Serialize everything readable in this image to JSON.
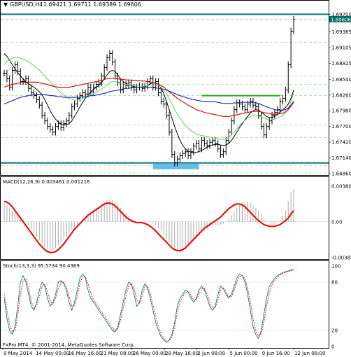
{
  "header": {
    "symbol_text": "GBPUSD,H4",
    "ohlc_text": "1.69421 1.69711 1.69389 1.69606"
  },
  "indicators": {
    "macd_label": "MACD(12,26,9) 0.003461 0.001216",
    "stoch_label": "Stoch(13,3,3) 95.5734 90.4369"
  },
  "copyright": "FxPro MT4, © 2001-2014, MetaQuotes Software Corp.",
  "colors": {
    "price_bars": "#000000",
    "ma_slow": "#2233aa",
    "ma_mid": "#cc1111",
    "ma_fast_green": "#66cc66",
    "ma_dark": "#000000",
    "support_line": "#117777",
    "resistance_mark": "#22aa22",
    "highlight_box": "#66bbee",
    "macd_line": "#ee0000",
    "macd_hist": "#aaaaaa",
    "stoch_main": "#008080",
    "stoch_signal": "#ee0000",
    "price_tag_bg": "#006666"
  },
  "chart_data": [
    {
      "type": "line",
      "name": "price",
      "x_labels": [
        "9 May 2014",
        "14 May 00:00",
        "16 May 16:00",
        "21 May 08:00",
        "26 May 00:00",
        "28 May 16:00",
        "2 Jun 08:00",
        "5 Jun 00:00",
        "9 Jun 16:00",
        "12 Jun 08:00"
      ],
      "y_ticks": [
        "1.69700",
        "1.69385",
        "1.69105",
        "1.68825",
        "1.68540",
        "1.68260",
        "1.67980",
        "1.67700",
        "1.67420",
        "1.67140",
        "1.66860"
      ],
      "price_tags": [
        "1.69700",
        "1.69606",
        "1.69600",
        "1.69200",
        "1.68600",
        "1.68450",
        "1.68250",
        "1.67725",
        "1.67500",
        "1.67000",
        "1.67050",
        "1.66870"
      ],
      "ylim": [
        1.6686,
        1.6978
      ],
      "close": [
        1.6865,
        1.6855,
        1.684,
        1.687,
        1.688,
        1.6868,
        1.685,
        1.685,
        1.6855,
        1.6838,
        1.683,
        1.6825,
        1.6818,
        1.6808,
        1.679,
        1.678,
        1.677,
        1.6765,
        1.676,
        1.677,
        1.6775,
        1.6768,
        1.6775,
        1.678,
        1.679,
        1.6805,
        1.681,
        1.682,
        1.6825,
        1.683,
        1.6828,
        1.684,
        1.6832,
        1.684,
        1.6845,
        1.6848,
        1.686,
        1.6875,
        1.6893,
        1.69,
        1.6885,
        1.686,
        1.6848,
        1.6835,
        1.6845,
        1.6843,
        1.6848,
        1.684,
        1.6835,
        1.684,
        1.6842,
        1.6838,
        1.6842,
        1.685,
        1.6855,
        1.684,
        1.685,
        1.683,
        1.6815,
        1.681,
        1.679,
        1.676,
        1.672,
        1.6705,
        1.6712,
        1.6718,
        1.6722,
        1.6725,
        1.6718,
        1.6725,
        1.6735,
        1.674,
        1.673,
        1.6745,
        1.674,
        1.6736,
        1.6742,
        1.6745,
        1.674,
        1.673,
        1.672,
        1.6725,
        1.6745,
        1.676,
        1.678,
        1.68,
        1.6812,
        1.681,
        1.6805,
        1.68,
        1.681,
        1.6815,
        1.6808,
        1.6805,
        1.679,
        1.677,
        1.6755,
        1.677,
        1.678,
        1.679,
        1.6795,
        1.68,
        1.6815,
        1.682,
        1.6835,
        1.688,
        1.694,
        1.6961
      ],
      "ma_blue": [
        1.681,
        1.6812,
        1.6814,
        1.6816,
        1.6818,
        1.682,
        1.6822,
        1.6823,
        1.6824,
        1.6825,
        1.6826,
        1.6827,
        1.6827,
        1.6827,
        1.6827,
        1.6827,
        1.6826,
        1.6825,
        1.6825,
        1.6824,
        1.6823,
        1.6823,
        1.6822,
        1.6822,
        1.6822,
        1.6822,
        1.6822,
        1.6822,
        1.6822,
        1.6823,
        1.6823,
        1.6824,
        1.6825,
        1.6825,
        1.6826,
        1.6827,
        1.6828,
        1.6829,
        1.683,
        1.6832,
        1.6833,
        1.6834,
        1.6835,
        1.6836,
        1.6837,
        1.6838,
        1.6838,
        1.6839,
        1.6839,
        1.684,
        1.684,
        1.684,
        1.684,
        1.684,
        1.684,
        1.6839,
        1.6839,
        1.6838,
        1.6837,
        1.6836,
        1.6835,
        1.6833,
        1.6831,
        1.6829,
        1.6827,
        1.6825,
        1.6823,
        1.6822,
        1.682,
        1.6819,
        1.6818,
        1.6817,
        1.6816,
        1.6815,
        1.6815,
        1.6814,
        1.6814,
        1.6814,
        1.6814,
        1.6813,
        1.6812,
        1.6811,
        1.6811,
        1.6811,
        1.6811,
        1.6812,
        1.6812,
        1.6813,
        1.6813,
        1.6813,
        1.6813,
        1.6813,
        1.6813,
        1.6812,
        1.6811,
        1.6809,
        1.6807,
        1.6805,
        1.6803,
        1.6802,
        1.68,
        1.6799,
        1.6799,
        1.6799,
        1.68,
        1.6803,
        1.6808,
        1.6815
      ],
      "ma_red": [
        1.684,
        1.6842,
        1.6843,
        1.6845,
        1.6846,
        1.6847,
        1.6848,
        1.6848,
        1.6849,
        1.6849,
        1.6849,
        1.6849,
        1.6849,
        1.6848,
        1.6847,
        1.6846,
        1.6845,
        1.6843,
        1.6842,
        1.6841,
        1.684,
        1.684,
        1.684,
        1.684,
        1.684,
        1.6841,
        1.6842,
        1.6843,
        1.6844,
        1.6845,
        1.6846,
        1.6847,
        1.6848,
        1.6849,
        1.685,
        1.6851,
        1.6852,
        1.6854,
        1.6855,
        1.6856,
        1.6856,
        1.6855,
        1.6855,
        1.6854,
        1.6854,
        1.6853,
        1.6853,
        1.6852,
        1.6852,
        1.6852,
        1.6852,
        1.6851,
        1.6851,
        1.685,
        1.6849,
        1.6848,
        1.6847,
        1.6845,
        1.6843,
        1.684,
        1.6836,
        1.6832,
        1.6828,
        1.6824,
        1.682,
        1.6817,
        1.6814,
        1.6811,
        1.6808,
        1.6805,
        1.6803,
        1.68,
        1.6798,
        1.6797,
        1.6795,
        1.6794,
        1.6793,
        1.6792,
        1.6791,
        1.679,
        1.6789,
        1.6788,
        1.6788,
        1.6788,
        1.6789,
        1.679,
        1.6791,
        1.6792,
        1.6793,
        1.6794,
        1.6795,
        1.6796,
        1.6797,
        1.6797,
        1.6797,
        1.6796,
        1.6795,
        1.6794,
        1.6793,
        1.6792,
        1.6792,
        1.6792,
        1.6793,
        1.6794,
        1.6796,
        1.68,
        1.6806,
        1.6813
      ],
      "ma_green": [
        1.688,
        1.6885,
        1.689,
        1.6892,
        1.6893,
        1.6893,
        1.6892,
        1.689,
        1.6888,
        1.6885,
        1.6882,
        1.6878,
        1.6874,
        1.687,
        1.6865,
        1.686,
        1.6855,
        1.685,
        1.6845,
        1.684,
        1.6835,
        1.683,
        1.6826,
        1.6822,
        1.682,
        1.6818,
        1.6817,
        1.6817,
        1.6818,
        1.682,
        1.6822,
        1.6825,
        1.6827,
        1.6829,
        1.6831,
        1.6834,
        1.6837,
        1.684,
        1.6844,
        1.6848,
        1.685,
        1.685,
        1.685,
        1.6848,
        1.6846,
        1.6845,
        1.6845,
        1.6844,
        1.6843,
        1.6843,
        1.6842,
        1.6842,
        1.6842,
        1.6843,
        1.6844,
        1.6844,
        1.6844,
        1.6843,
        1.684,
        1.6835,
        1.6828,
        1.682,
        1.681,
        1.68,
        1.6792,
        1.6785,
        1.6778,
        1.6772,
        1.6767,
        1.6763,
        1.676,
        1.6757,
        1.6755,
        1.6754,
        1.6753,
        1.6752,
        1.6751,
        1.675,
        1.6749,
        1.6748,
        1.6747,
        1.6747,
        1.6748,
        1.675,
        1.6755,
        1.676,
        1.6766,
        1.6772,
        1.6777,
        1.6781,
        1.6785,
        1.6788,
        1.679,
        1.679,
        1.6789,
        1.6787,
        1.6785,
        1.6783,
        1.6782,
        1.6782,
        1.6783,
        1.6785,
        1.6787,
        1.679,
        1.6794,
        1.6802,
        1.6815,
        1.683
      ],
      "ma_black": [
        1.69,
        1.6895,
        1.6888,
        1.688,
        1.6873,
        1.6866,
        1.686,
        1.6855,
        1.685,
        1.6846,
        1.6843,
        1.684,
        1.6836,
        1.6832,
        1.6826,
        1.6818,
        1.6808,
        1.6798,
        1.679,
        1.6783,
        1.6778,
        1.6775,
        1.6773,
        1.6773,
        1.6775,
        1.678,
        1.6788,
        1.6796,
        1.6805,
        1.6813,
        1.682,
        1.6826,
        1.6832,
        1.6836,
        1.684,
        1.6843,
        1.6848,
        1.6855,
        1.6862,
        1.6868,
        1.687,
        1.6868,
        1.6862,
        1.6855,
        1.685,
        1.6847,
        1.6845,
        1.6843,
        1.6841,
        1.684,
        1.684,
        1.684,
        1.6841,
        1.6843,
        1.6846,
        1.6848,
        1.6848,
        1.6845,
        1.6838,
        1.6828,
        1.6815,
        1.68,
        1.6785,
        1.677,
        1.6757,
        1.6745,
        1.6736,
        1.673,
        1.6726,
        1.6724,
        1.6723,
        1.6724,
        1.6725,
        1.6727,
        1.673,
        1.6733,
        1.6735,
        1.6737,
        1.6738,
        1.6738,
        1.6737,
        1.6736,
        1.6737,
        1.674,
        1.6745,
        1.6752,
        1.676,
        1.6768,
        1.6775,
        1.6782,
        1.6788,
        1.6794,
        1.6798,
        1.68,
        1.6799,
        1.6796,
        1.6792,
        1.6788,
        1.6786,
        1.6786,
        1.6788,
        1.6792,
        1.6796,
        1.68,
        1.6804,
        1.681,
        1.682,
        1.6835
      ]
    },
    {
      "type": "bar",
      "name": "macd",
      "y_ticks": [
        "0.003809",
        "0.00",
        "-0.003845"
      ],
      "ylim": [
        -0.003845,
        0.003809
      ],
      "histogram": [
        0.002,
        0.0018,
        0.0015,
        0.0012,
        0.001,
        0.0008,
        0.0005,
        0.0002,
        -0.0001,
        -0.0004,
        -0.0008,
        -0.0012,
        -0.0016,
        -0.002,
        -0.0024,
        -0.0027,
        -0.0029,
        -0.003,
        -0.003,
        -0.0028,
        -0.0025,
        -0.0022,
        -0.0019,
        -0.0016,
        -0.0012,
        -0.0009,
        -0.0006,
        -0.0003,
        0.0,
        0.0003,
        0.0006,
        0.0009,
        0.0011,
        0.0013,
        0.0015,
        0.0017,
        0.0019,
        0.0021,
        0.0023,
        0.0024,
        0.0023,
        0.0021,
        0.0018,
        0.0015,
        0.0012,
        0.0009,
        0.0006,
        0.0003,
        0.0001,
        0.0,
        -0.0001,
        -0.0001,
        -0.0001,
        0.0,
        -0.0001,
        -0.0002,
        -0.0004,
        -0.0007,
        -0.001,
        -0.0014,
        -0.0018,
        -0.0022,
        -0.0026,
        -0.003,
        -0.0032,
        -0.0033,
        -0.0032,
        -0.003,
        -0.0027,
        -0.0024,
        -0.0021,
        -0.0018,
        -0.0015,
        -0.0012,
        -0.001,
        -0.0008,
        -0.0006,
        -0.0005,
        -0.0004,
        -0.0004,
        -0.0003,
        -0.0002,
        0.0,
        0.0003,
        0.0007,
        0.0011,
        0.0015,
        0.0018,
        0.002,
        0.0021,
        0.0021,
        0.002,
        0.0018,
        0.0015,
        0.0012,
        0.0008,
        0.0004,
        0.0001,
        -0.0001,
        -0.0002,
        -0.0002,
        -0.0001,
        0.0002,
        0.0006,
        0.0012,
        0.0022,
        0.0032,
        0.0035
      ],
      "signal": [
        0.0022,
        0.0021,
        0.0019,
        0.0016,
        0.0012,
        0.0008,
        0.0004,
        0.0,
        -0.0004,
        -0.0008,
        -0.0012,
        -0.0016,
        -0.002,
        -0.0024,
        -0.0027,
        -0.003,
        -0.0032,
        -0.0033,
        -0.0033,
        -0.0032,
        -0.003,
        -0.0027,
        -0.0024,
        -0.002,
        -0.0016,
        -0.0012,
        -0.0008,
        -0.0005,
        -0.0002,
        0.0001,
        0.0004,
        0.0007,
        0.0009,
        0.0011,
        0.0013,
        0.0015,
        0.0017,
        0.0019,
        0.002,
        0.002,
        0.0019,
        0.0017,
        0.0014,
        0.0011,
        0.0008,
        0.0005,
        0.0003,
        0.0001,
        0.0,
        -0.0001,
        -0.0001,
        -0.0001,
        -0.0002,
        -0.0003,
        -0.0005,
        -0.0007,
        -0.001,
        -0.0013,
        -0.0016,
        -0.0019,
        -0.0022,
        -0.0025,
        -0.0028,
        -0.003,
        -0.0031,
        -0.0031,
        -0.003,
        -0.0028,
        -0.0025,
        -0.0022,
        -0.0019,
        -0.0016,
        -0.0013,
        -0.001,
        -0.0007,
        -0.0005,
        -0.0003,
        -0.0001,
        0.0001,
        0.0003,
        0.0005,
        0.0008,
        0.0011,
        0.0014,
        0.0016,
        0.0018,
        0.0019,
        0.0019,
        0.0018,
        0.0016,
        0.0013,
        0.001,
        0.0007,
        0.0004,
        0.0001,
        -0.0001,
        -0.0003,
        -0.0004,
        -0.0005,
        -0.0005,
        -0.0005,
        -0.0004,
        -0.0003,
        -0.0001,
        0.0001,
        0.0004,
        0.0008,
        0.0012
      ]
    },
    {
      "type": "line",
      "name": "stochastic",
      "y_ticks": [
        "100",
        "80",
        "20",
        "0"
      ],
      "ylim": [
        0,
        100
      ],
      "main": [
        60,
        35,
        20,
        15,
        25,
        50,
        80,
        88,
        80,
        65,
        50,
        45,
        55,
        70,
        80,
        75,
        60,
        50,
        55,
        65,
        80,
        82,
        78,
        70,
        55,
        45,
        55,
        70,
        85,
        90,
        85,
        70,
        60,
        55,
        50,
        45,
        40,
        35,
        30,
        25,
        20,
        18,
        25,
        40,
        55,
        70,
        80,
        78,
        65,
        50,
        55,
        70,
        78,
        72,
        60,
        45,
        30,
        20,
        12,
        8,
        5,
        8,
        15,
        30,
        50,
        60,
        65,
        70,
        68,
        60,
        55,
        60,
        70,
        75,
        70,
        60,
        50,
        45,
        50,
        65,
        75,
        72,
        65,
        60,
        65,
        75,
        85,
        90,
        88,
        80,
        65,
        45,
        25,
        15,
        10,
        20,
        40,
        60,
        75,
        80,
        85,
        88,
        90,
        92,
        93,
        94,
        95,
        96
      ],
      "signal": [
        65,
        45,
        28,
        18,
        20,
        38,
        65,
        82,
        84,
        72,
        56,
        48,
        50,
        62,
        75,
        77,
        68,
        56,
        52,
        60,
        72,
        80,
        80,
        74,
        62,
        50,
        50,
        62,
        78,
        87,
        87,
        78,
        66,
        58,
        53,
        48,
        43,
        38,
        33,
        28,
        23,
        20,
        22,
        33,
        48,
        62,
        75,
        78,
        72,
        58,
        54,
        63,
        74,
        75,
        66,
        52,
        38,
        25,
        16,
        10,
        7,
        7,
        12,
        24,
        42,
        55,
        62,
        67,
        68,
        64,
        58,
        58,
        65,
        72,
        72,
        65,
        55,
        48,
        48,
        58,
        70,
        73,
        68,
        62,
        62,
        70,
        80,
        87,
        88,
        84,
        72,
        55,
        35,
        20,
        13,
        16,
        30,
        50,
        67,
        77,
        82,
        86,
        89,
        91,
        92,
        93,
        94,
        95
      ]
    }
  ]
}
